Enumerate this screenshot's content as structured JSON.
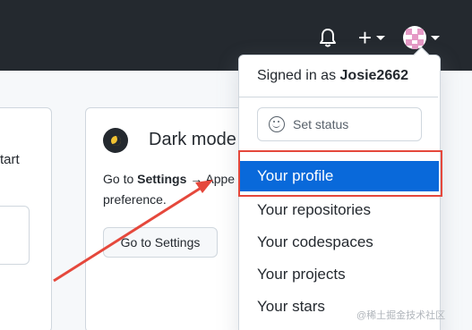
{
  "header": {
    "notifications_icon": "bell-icon",
    "create_icon": "plus-icon",
    "avatar_icon": "avatar-icon"
  },
  "cards": {
    "left_fragment": "tart",
    "dark_mode": {
      "title": "Dark mode",
      "desc_prefix": "Go to ",
      "desc_settings": "Settings",
      "desc_arrow": " → Appe",
      "desc_line2": "preference.",
      "button_label": "Go to Settings"
    }
  },
  "dropdown": {
    "signed_in_prefix": "Signed in as ",
    "username": "Josie2662",
    "set_status_label": "Set status",
    "items": [
      {
        "label": "Your profile",
        "active": true
      },
      {
        "label": "Your repositories"
      },
      {
        "label": "Your codespaces"
      },
      {
        "label": "Your projects"
      },
      {
        "label": "Your stars"
      }
    ]
  },
  "annotation": {
    "highlight_color": "#e5483c",
    "arrow_color": "#e5483c"
  },
  "colors": {
    "header_bg": "#24292f",
    "accent": "#0969da"
  },
  "watermark": "@稀土掘金技术社区"
}
